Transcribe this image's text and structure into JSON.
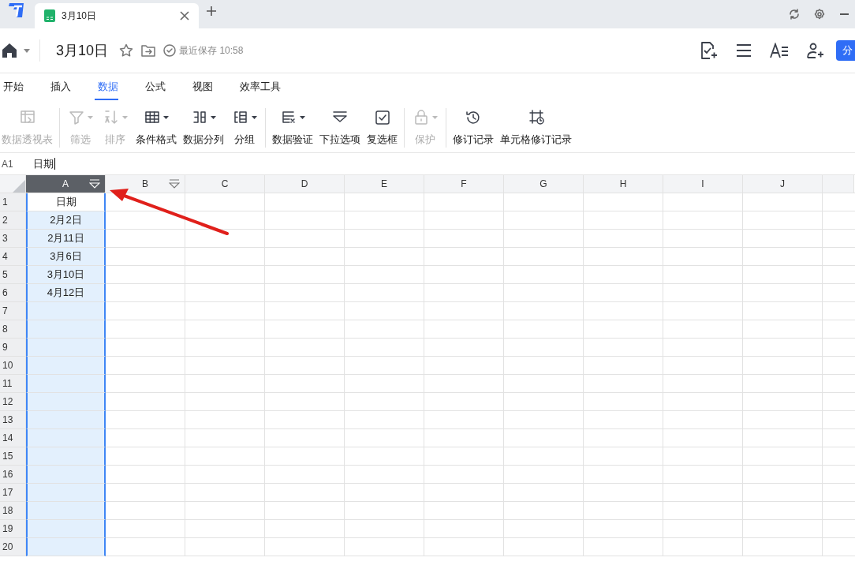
{
  "tabs": [
    {
      "label": "3月10日",
      "selected": true
    }
  ],
  "header": {
    "title": "3月10日",
    "last_saved": "最近保存 10:58",
    "share_button": "分"
  },
  "ribbon_tabs": [
    {
      "label": "开始",
      "selected": false
    },
    {
      "label": "插入",
      "selected": false
    },
    {
      "label": "数据",
      "selected": true
    },
    {
      "label": "公式",
      "selected": false
    },
    {
      "label": "视图",
      "selected": false
    },
    {
      "label": "效率工具",
      "selected": false
    }
  ],
  "toolbar": {
    "groups": [
      [
        {
          "label": "数据透视表",
          "disabled": true,
          "dropdown": false
        }
      ],
      [
        {
          "label": "筛选",
          "disabled": true,
          "dropdown": true
        },
        {
          "label": "排序",
          "disabled": true,
          "dropdown": true
        },
        {
          "label": "条件格式",
          "disabled": false,
          "dropdown": true
        },
        {
          "label": "数据分列",
          "disabled": false,
          "dropdown": true
        },
        {
          "label": "分组",
          "disabled": false,
          "dropdown": true
        }
      ],
      [
        {
          "label": "数据验证",
          "disabled": false,
          "dropdown": true
        },
        {
          "label": "下拉选项",
          "disabled": false,
          "dropdown": false
        },
        {
          "label": "复选框",
          "disabled": false,
          "dropdown": false
        }
      ],
      [
        {
          "label": "保护",
          "disabled": true,
          "dropdown": true
        }
      ],
      [
        {
          "label": "修订记录",
          "disabled": false,
          "dropdown": false
        },
        {
          "label": "单元格修订记录",
          "disabled": false,
          "dropdown": false
        }
      ]
    ]
  },
  "formula_bar": {
    "cell_ref": "A1",
    "value": "日期"
  },
  "sheet": {
    "columns": [
      {
        "label": "A",
        "selected": true,
        "filter": true
      },
      {
        "label": "B",
        "selected": false,
        "filter": true
      },
      {
        "label": "C",
        "selected": false,
        "filter": false
      },
      {
        "label": "D",
        "selected": false,
        "filter": false
      },
      {
        "label": "E",
        "selected": false,
        "filter": false
      },
      {
        "label": "F",
        "selected": false,
        "filter": false
      },
      {
        "label": "G",
        "selected": false,
        "filter": false
      },
      {
        "label": "H",
        "selected": false,
        "filter": false
      },
      {
        "label": "I",
        "selected": false,
        "filter": false
      },
      {
        "label": "J",
        "selected": false,
        "filter": false
      }
    ],
    "rows": [
      {
        "number": "1",
        "cells": [
          "日期"
        ]
      },
      {
        "number": "2",
        "cells": [
          "2月2日"
        ]
      },
      {
        "number": "3",
        "cells": [
          "2月11日"
        ]
      },
      {
        "number": "4",
        "cells": [
          "3月6日"
        ]
      },
      {
        "number": "5",
        "cells": [
          "3月10日"
        ]
      },
      {
        "number": "6",
        "cells": [
          "4月12日"
        ]
      },
      {
        "number": "7",
        "cells": []
      },
      {
        "number": "8",
        "cells": []
      },
      {
        "number": "9",
        "cells": []
      },
      {
        "number": "10",
        "cells": []
      },
      {
        "number": "11",
        "cells": []
      },
      {
        "number": "12",
        "cells": []
      },
      {
        "number": "13",
        "cells": []
      },
      {
        "number": "14",
        "cells": []
      },
      {
        "number": "15",
        "cells": []
      },
      {
        "number": "16",
        "cells": []
      },
      {
        "number": "17",
        "cells": []
      },
      {
        "number": "18",
        "cells": []
      },
      {
        "number": "19",
        "cells": []
      },
      {
        "number": "20",
        "cells": []
      }
    ]
  }
}
